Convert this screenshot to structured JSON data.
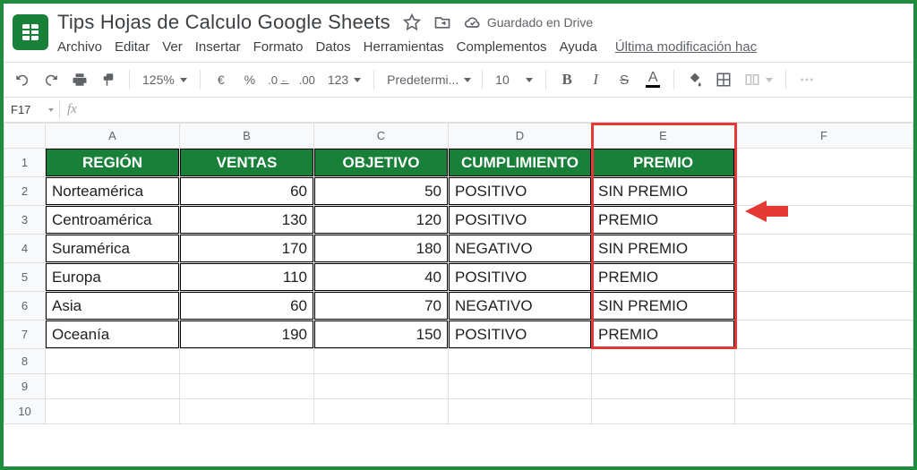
{
  "doc_title": "Tips Hojas de Calculo Google Sheets",
  "drive_status": "Guardado en Drive",
  "menus": {
    "file": "Archivo",
    "edit": "Editar",
    "view": "Ver",
    "insert": "Insertar",
    "format": "Formato",
    "data": "Datos",
    "tools": "Herramientas",
    "addons": "Complementos",
    "help": "Ayuda",
    "last_mod": "Última modificación hac"
  },
  "toolbar": {
    "zoom": "125%",
    "currency": "€",
    "percent": "%",
    "dec_dec": ".0",
    "dec_inc": ".00",
    "num_fmt": "123",
    "font": "Predetermi...",
    "font_size": "10",
    "bold": "B",
    "italic": "I",
    "strike": "S",
    "text_color": "A"
  },
  "namebox": "F17",
  "fx": "fx",
  "cols": [
    "A",
    "B",
    "C",
    "D",
    "E",
    "F"
  ],
  "rows": [
    "1",
    "2",
    "3",
    "4",
    "5",
    "6",
    "7",
    "8",
    "9",
    "10"
  ],
  "headers": {
    "A": "REGIÓN",
    "B": "VENTAS",
    "C": "OBJETIVO",
    "D": "CUMPLIMIENTO",
    "E": "PREMIO"
  },
  "data": [
    {
      "A": "Norteamérica",
      "B": "60",
      "C": "50",
      "D": "POSITIVO",
      "E": "SIN PREMIO"
    },
    {
      "A": "Centroamérica",
      "B": "130",
      "C": "120",
      "D": "POSITIVO",
      "E": "PREMIO"
    },
    {
      "A": "Suramérica",
      "B": "170",
      "C": "180",
      "D": "NEGATIVO",
      "E": "SIN PREMIO"
    },
    {
      "A": "Europa",
      "B": "110",
      "C": "40",
      "D": "POSITIVO",
      "E": "PREMIO"
    },
    {
      "A": "Asia",
      "B": "60",
      "C": "70",
      "D": "NEGATIVO",
      "E": "SIN PREMIO"
    },
    {
      "A": "Oceanía",
      "B": "190",
      "C": "150",
      "D": "POSITIVO",
      "E": "PREMIO"
    }
  ]
}
